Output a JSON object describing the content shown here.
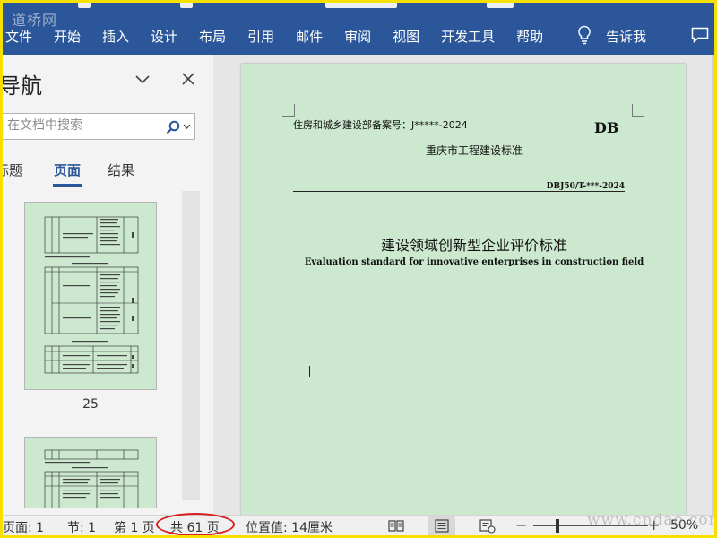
{
  "ribbon": {
    "menu": [
      "文件",
      "开始",
      "插入",
      "设计",
      "布局",
      "引用",
      "邮件",
      "审阅",
      "视图",
      "开发工具",
      "帮助"
    ],
    "tell_me": "告诉我",
    "watermark": "道桥网"
  },
  "nav": {
    "title": "导航",
    "search_placeholder": "在文档中搜索",
    "tabs": [
      "标题",
      "页面",
      "结果"
    ],
    "active_tab": "页面",
    "thumbnail_page_label": "25"
  },
  "document": {
    "record_number": "住房和城乡建设部备案号：J*****-2024",
    "db_mark": "DB",
    "standard_name": "重庆市工程建设标准",
    "standard_code": "DBJ50/T-***-2024",
    "title_zh": "建设领域创新型企业评价标准",
    "title_en": "Evaluation standard for innovative enterprises in construction field"
  },
  "status": {
    "page": "页面: 1",
    "section": "节: 1",
    "page_of": "第 1 页",
    "total_pages": "共 61 页",
    "position": "位置值: 14厘米",
    "zoom": "50%",
    "zoom_level_percent": 50
  },
  "watermark_bottom": "www.cndao.com",
  "colors": {
    "ribbon": "#2b579a",
    "page_background": "#cce8cf",
    "highlight": "#d81e1e",
    "outer_border": "#f5e000"
  }
}
